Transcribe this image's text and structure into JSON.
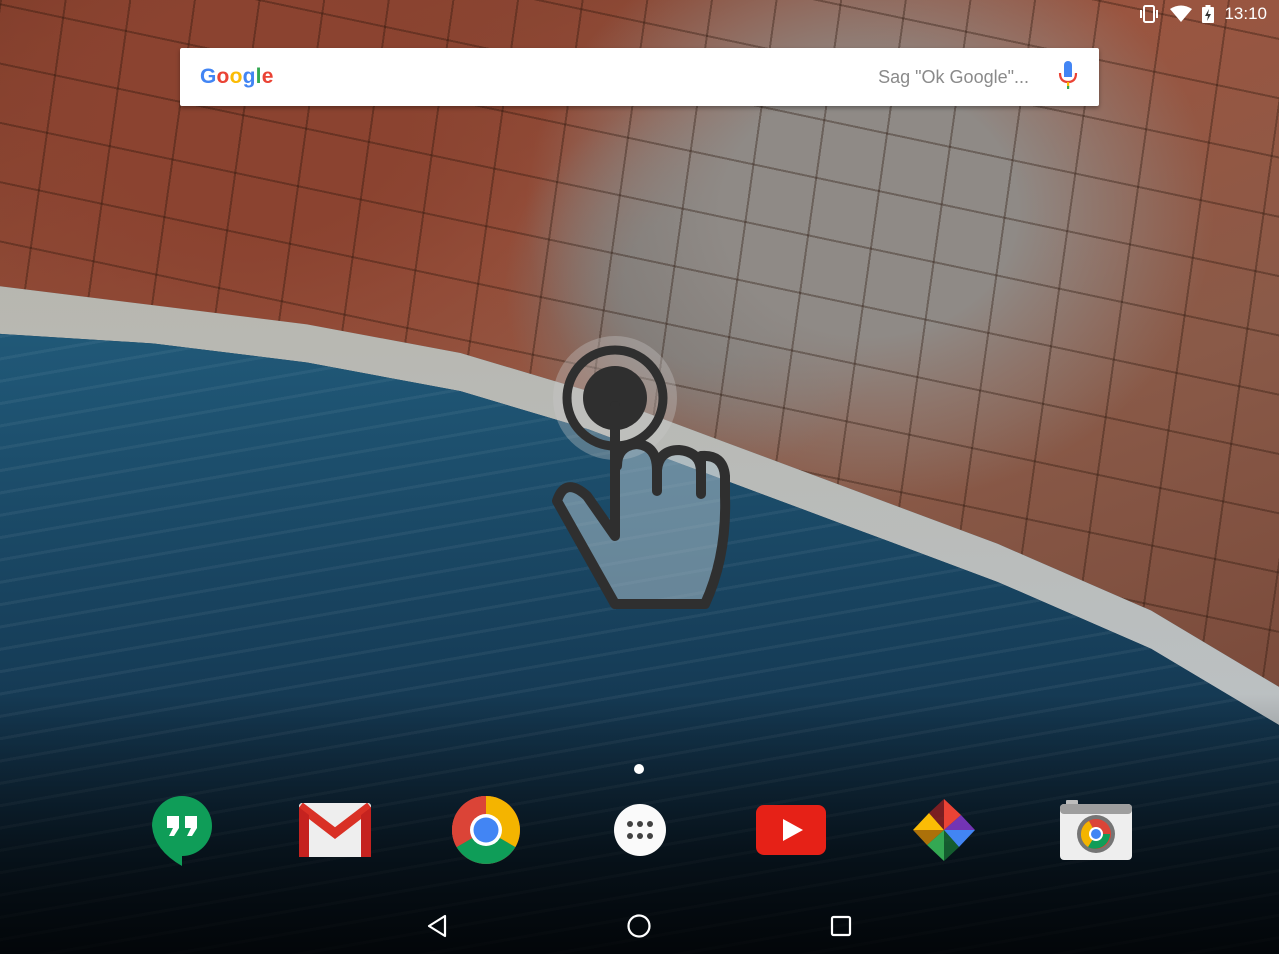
{
  "status_bar": {
    "time": "13:10",
    "icons": [
      "vibrate-icon",
      "wifi-icon",
      "battery-charging-icon"
    ]
  },
  "search": {
    "logo_letters": [
      {
        "char": "G",
        "color": "#4285F4"
      },
      {
        "char": "o",
        "color": "#EA4335"
      },
      {
        "char": "o",
        "color": "#FBBC05"
      },
      {
        "char": "g",
        "color": "#4285F4"
      },
      {
        "char": "l",
        "color": "#34A853"
      },
      {
        "char": "e",
        "color": "#EA4335"
      }
    ],
    "placeholder": "Sag \"Ok Google\"..."
  },
  "dock": {
    "apps": [
      {
        "name": "Hangouts",
        "icon": "hangouts-icon"
      },
      {
        "name": "Gmail",
        "icon": "gmail-icon"
      },
      {
        "name": "Chrome",
        "icon": "chrome-icon"
      },
      {
        "name": "Apps",
        "icon": "app-drawer-icon"
      },
      {
        "name": "YouTube",
        "icon": "youtube-icon"
      },
      {
        "name": "Photos",
        "icon": "photos-icon"
      },
      {
        "name": "Camera",
        "icon": "camera-icon"
      }
    ]
  },
  "home_pages": {
    "count": 1,
    "current": 1
  },
  "navigation": {
    "buttons": [
      "back-icon",
      "home-icon",
      "recents-icon"
    ]
  },
  "colors": {
    "hangouts": "#0F9D58",
    "gmail_red": "#D93025",
    "youtube": "#E62117",
    "chrome_red": "#DB4437",
    "chrome_yellow": "#F4B400",
    "chrome_green": "#0F9D58",
    "chrome_blue": "#4285F4"
  }
}
